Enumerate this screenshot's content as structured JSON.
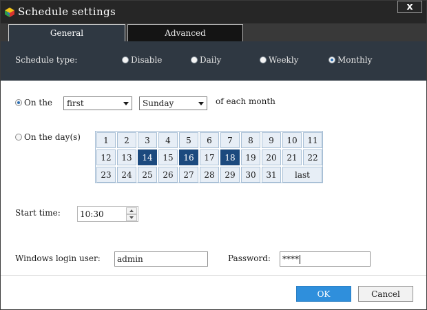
{
  "window": {
    "title": "Schedule settings",
    "close_label": "x"
  },
  "tabs": [
    {
      "label": "General",
      "active": true
    },
    {
      "label": "Advanced",
      "active": false
    }
  ],
  "schedule_type": {
    "label": "Schedule type:",
    "options": [
      {
        "label": "Disable",
        "selected": false
      },
      {
        "label": "Daily",
        "selected": false
      },
      {
        "label": "Weekly",
        "selected": false
      },
      {
        "label": "Monthly",
        "selected": true
      }
    ]
  },
  "monthly": {
    "on_the": {
      "label": "On the",
      "selected": true,
      "ordinal": "first",
      "weekday": "Sunday",
      "suffix": "of each month"
    },
    "on_days": {
      "label": "On the day(s)",
      "selected": false,
      "days": [
        "1",
        "2",
        "3",
        "4",
        "5",
        "6",
        "7",
        "8",
        "9",
        "10",
        "11",
        "12",
        "13",
        "14",
        "15",
        "16",
        "17",
        "18",
        "19",
        "20",
        "21",
        "22",
        "23",
        "24",
        "25",
        "26",
        "27",
        "28",
        "29",
        "30",
        "31",
        "last"
      ],
      "selected_days": [
        "14",
        "16",
        "18"
      ]
    }
  },
  "start_time": {
    "label": "Start time:",
    "value": "10:30"
  },
  "login": {
    "user_label": "Windows login user:",
    "user_value": "admin",
    "password_label": "Password:",
    "password_value": "****"
  },
  "buttons": {
    "ok": "OK",
    "cancel": "Cancel"
  },
  "colors": {
    "title_bar": "#262626",
    "band": "#2f3842",
    "selected_day": "#1c4a7e",
    "ok_button": "#2f8fdc"
  }
}
